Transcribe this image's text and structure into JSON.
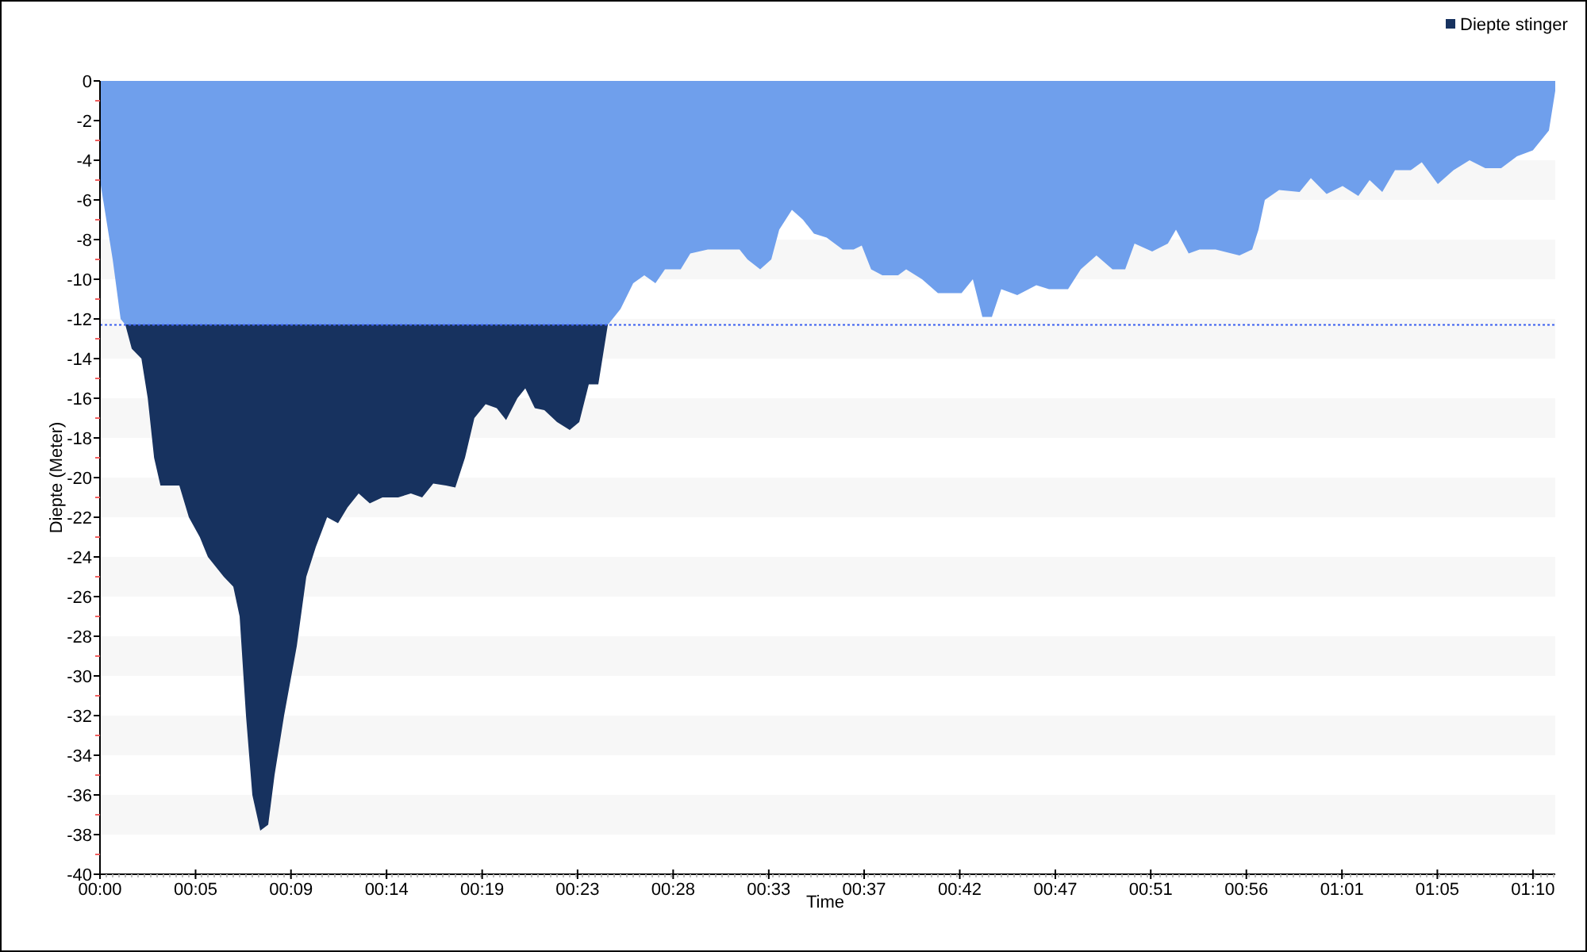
{
  "chart_data": {
    "type": "area",
    "xlabel": "Time",
    "ylabel": "Diepte (Meter)",
    "x": [
      0,
      0.62,
      1.01,
      1.24,
      1.55,
      2.02,
      2.33,
      2.64,
      2.95,
      3.88,
      4.34,
      4.88,
      5.27,
      6.05,
      6.51,
      6.82,
      7.13,
      7.44,
      7.83,
      8.22,
      8.53,
      8.99,
      9.61,
      10.08,
      10.54,
      11.09,
      11.63,
      12.09,
      12.64,
      13.18,
      13.8,
      14.57,
      15.19,
      15.74,
      16.28,
      16.9,
      17.36,
      17.83,
      18.29,
      18.84,
      19.38,
      19.84,
      20.39,
      20.78,
      21.24,
      21.71,
      22.33,
      22.95,
      23.41,
      23.88,
      24.34,
      24.81,
      25.43,
      26.05,
      26.59,
      27.13,
      27.6,
      28.37,
      28.84,
      29.69,
      31.24,
      31.63,
      32.25,
      32.79,
      33.18,
      33.8,
      34.34,
      34.88,
      35.5,
      36.28,
      36.82,
      37.21,
      37.67,
      38.22,
      38.99,
      39.38,
      40.16,
      40.93,
      42.09,
      42.64,
      43.1,
      43.57,
      44.03,
      44.81,
      45.74,
      46.36,
      47.29,
      47.91,
      48.68,
      49.46,
      50.08,
      50.54,
      51.4,
      52.17,
      52.56,
      53.18,
      53.72,
      54.5,
      55.66,
      56.28,
      56.59,
      56.9,
      57.6,
      58.6,
      59.15,
      59.92,
      60.7,
      61.47,
      62.02,
      62.64,
      63.26,
      64.03,
      64.57,
      65.35,
      66.12,
      66.9,
      67.67,
      68.45,
      69.22,
      70,
      70.78,
      71.09
    ],
    "series": [
      {
        "name": "Diepte stinger",
        "color": "#17325f",
        "values": [
          -5,
          -9,
          -12,
          -12.3,
          -13.5,
          -14,
          -16,
          -19,
          -20.4,
          -20.4,
          -22,
          -23,
          -24,
          -25,
          -25.5,
          -27,
          -32,
          -36,
          -37.8,
          -37.5,
          -35,
          -32,
          -28.5,
          -25,
          -23.5,
          -22,
          -22.3,
          -21.5,
          -20.8,
          -21.3,
          -21,
          -21,
          -20.8,
          -21,
          -20.3,
          -20.4,
          -20.5,
          -19,
          -17,
          -16.3,
          -16.5,
          -17.1,
          -16,
          -15.5,
          -16.5,
          -16.6,
          -17.2,
          -17.6,
          -17.2,
          -15.3,
          -15.3,
          -12.3,
          -11.5,
          -10.2,
          -9.8,
          -10.2,
          -9.5,
          -9.5,
          -8.7,
          -8.5,
          -8.5,
          -9,
          -9.5,
          -9,
          -7.5,
          -6.5,
          -7,
          -7.7,
          -7.9,
          -8.5,
          -8.5,
          -8.3,
          -9.5,
          -9.8,
          -9.8,
          -9.5,
          -10,
          -10.7,
          -10.7,
          -10,
          -11.9,
          -11.9,
          -10.5,
          -10.8,
          -10.3,
          -10.5,
          -10.5,
          -9.5,
          -8.8,
          -9.5,
          -9.5,
          -8.2,
          -8.6,
          -8.2,
          -7.5,
          -8.7,
          -8.5,
          -8.5,
          -8.8,
          -8.5,
          -7.5,
          -6,
          -5.5,
          -5.6,
          -4.9,
          -5.7,
          -5.3,
          -5.8,
          -5,
          -5.6,
          -4.5,
          -4.5,
          -4.1,
          -5.2,
          -4.5,
          -4,
          -4.4,
          -4.4,
          -3.8,
          -3.5,
          -2.5,
          -0.5
        ]
      }
    ],
    "xlim": [
      0,
      71.09
    ],
    "ylim": [
      -40,
      0
    ],
    "xticks": [
      {
        "value": 0,
        "label": "00:00"
      },
      {
        "value": 4.67,
        "label": "00:05"
      },
      {
        "value": 9.33,
        "label": "00:09"
      },
      {
        "value": 14,
        "label": "00:14"
      },
      {
        "value": 18.67,
        "label": "00:19"
      },
      {
        "value": 23.33,
        "label": "00:23"
      },
      {
        "value": 28,
        "label": "00:28"
      },
      {
        "value": 32.67,
        "label": "00:33"
      },
      {
        "value": 37.33,
        "label": "00:37"
      },
      {
        "value": 42,
        "label": "00:42"
      },
      {
        "value": 46.67,
        "label": "00:47"
      },
      {
        "value": 51.33,
        "label": "00:51"
      },
      {
        "value": 56,
        "label": "00:56"
      },
      {
        "value": 60.67,
        "label": "01:01"
      },
      {
        "value": 65.33,
        "label": "01:05"
      },
      {
        "value": 70,
        "label": "01:10"
      }
    ],
    "yticks": [
      0,
      -2,
      -4,
      -6,
      -8,
      -10,
      -12,
      -14,
      -16,
      -18,
      -20,
      -22,
      -24,
      -26,
      -28,
      -30,
      -32,
      -34,
      -36,
      -38,
      -40
    ],
    "ref_lines": [
      {
        "axis": "y",
        "value": -12.3
      }
    ]
  }
}
